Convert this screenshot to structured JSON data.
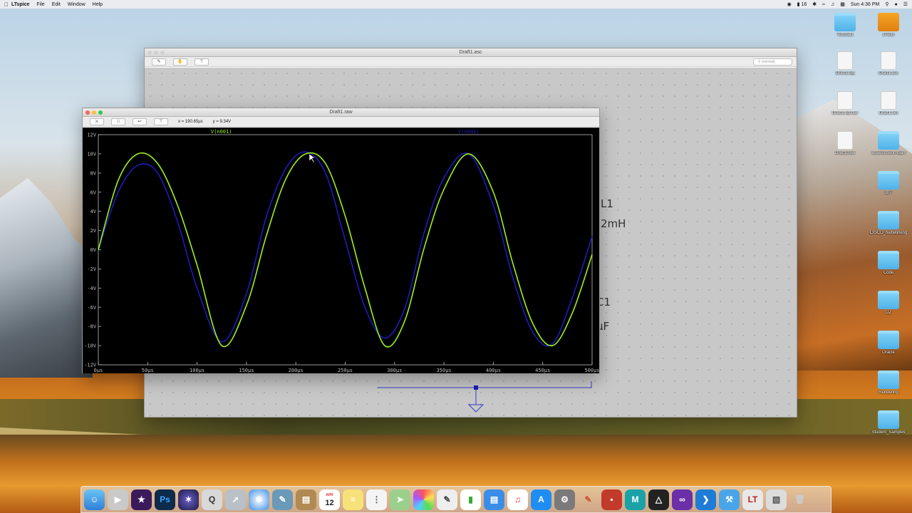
{
  "menubar": {
    "app_name": "LTspice",
    "items": [
      "File",
      "Edit",
      "Window",
      "Help"
    ],
    "battery": "16",
    "clock": "Sun 4:36 PM"
  },
  "schematic": {
    "title": "Draft1.asc",
    "search_placeholder": "(normal)",
    "labels": [
      "L1",
      "2mH",
      "C1",
      "µF"
    ]
  },
  "waveform": {
    "title": "Draft1.raw",
    "cursor_x": "x = 190.65µs",
    "cursor_y": "y = 9.34V"
  },
  "chart_data": {
    "type": "line",
    "trace_labels": [
      "V(n001)",
      "V(n002)"
    ],
    "x_ticks": [
      "0µs",
      "50µs",
      "100µs",
      "150µs",
      "200µs",
      "250µs",
      "300µs",
      "350µs",
      "400µs",
      "450µs",
      "500µs"
    ],
    "y_ticks": [
      "12V",
      "10V",
      "8V",
      "6V",
      "4V",
      "2V",
      "0V",
      "-2V",
      "-4V",
      "-6V",
      "-8V",
      "-10V",
      "-12V"
    ],
    "xlim": [
      0,
      500
    ],
    "ylim": [
      -12,
      12
    ],
    "series": [
      {
        "color": "#9cf21c",
        "x": [
          0,
          20,
          40,
          60,
          80,
          100,
          125,
          150,
          170,
          190,
          210,
          230,
          250,
          270,
          290,
          310,
          330,
          350,
          375,
          400,
          420,
          440,
          460,
          480,
          500
        ],
        "y": [
          0.0,
          7.2,
          10.0,
          9.0,
          4.7,
          -1.6,
          -10.0,
          -5.8,
          1.4,
          7.4,
          10.0,
          9.0,
          3.5,
          -4.0,
          -10.0,
          -7.5,
          0.2,
          6.3,
          10.0,
          6.0,
          -1.5,
          -7.7,
          -10.0,
          -6.6,
          -0.5
        ]
      },
      {
        "color": "#1c1cbc",
        "x": [
          0,
          20,
          40,
          60,
          80,
          100,
          125,
          150,
          170,
          190,
          210,
          230,
          250,
          270,
          290,
          310,
          330,
          350,
          375,
          400,
          420,
          440,
          460,
          480,
          500
        ],
        "y": [
          0.0,
          6.0,
          8.8,
          8.0,
          3.0,
          -4.0,
          -9.6,
          -4.6,
          3.4,
          8.5,
          10.2,
          8.0,
          1.0,
          -6.0,
          -9.2,
          -6.2,
          1.8,
          7.5,
          10.0,
          4.6,
          -3.0,
          -8.6,
          -9.8,
          -5.0,
          1.4
        ]
      }
    ]
  },
  "desktop_icons": [
    "Tutorials",
    "LTwiki",
    "Draft1.log",
    "Draft1.asc",
    "Draft1.op.raw",
    "Draft1.net",
    "Draft1.raw",
    "assessment_plan",
    "BIT",
    "CISCO_Networking",
    "Code",
    "DZ",
    "Oracle",
    "Rendering",
    "Student_Samples"
  ],
  "dock": {
    "calendar_day": "12",
    "calendar_month": "APR"
  }
}
